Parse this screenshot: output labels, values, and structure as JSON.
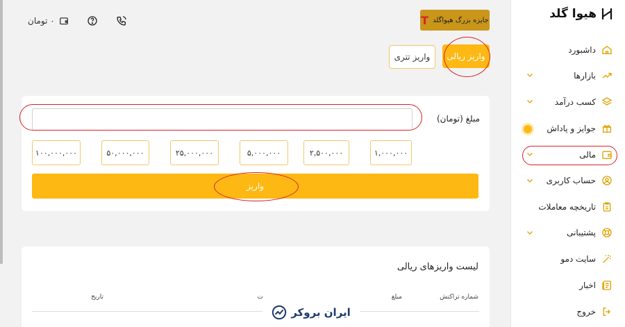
{
  "topbar": {
    "balance": "۰ تومان",
    "wallet_icon": "wallet-icon",
    "help_icon": "question-icon",
    "phone_icon": "phone-icon",
    "prize_label": "جایزه بزرگ هیواگلد",
    "prize_icon_letter": "T"
  },
  "tabs": [
    {
      "label": "واریز ریالی",
      "active": true
    },
    {
      "label": "واریز تتری",
      "active": false
    }
  ],
  "deposit": {
    "amount_label": "مبلغ (تومان)",
    "amount_value": "",
    "presets": [
      "۱,۰۰۰,۰۰۰",
      "۲,۵۰۰,۰۰۰",
      "۵,۰۰۰,۰۰۰",
      "۲۵,۰۰۰,۰۰۰",
      "۵۰,۰۰۰,۰۰۰",
      "۱۰۰,۰۰۰,۰۰۰"
    ],
    "submit_label": "واریز"
  },
  "list": {
    "title": "لیست واریزهای ریالی",
    "columns": [
      "شماره تراکنش",
      "مبلغ",
      "ت",
      "تاریخ"
    ]
  },
  "sidebar": {
    "logo_text": "هیوا گلد",
    "items": [
      {
        "label": "داشبورد",
        "icon": "home-icon",
        "has_chevron": false
      },
      {
        "label": "بازارها",
        "icon": "trending-up-icon",
        "has_chevron": true
      },
      {
        "label": "کسب درآمد",
        "icon": "layers-icon",
        "has_chevron": true
      },
      {
        "label": "جوایز و پاداش",
        "icon": "gift-icon",
        "has_chevron": false
      },
      {
        "label": "مالی",
        "icon": "wallet-icon",
        "has_chevron": true
      },
      {
        "label": "حساب کاربری",
        "icon": "user-icon",
        "has_chevron": true
      },
      {
        "label": "تاریخچه معاملات",
        "icon": "clipboard-icon",
        "has_chevron": false
      },
      {
        "label": "پشتیبانی",
        "icon": "lifebuoy-icon",
        "has_chevron": true
      },
      {
        "label": "سایت دمو",
        "icon": "magic-wand-icon",
        "has_chevron": false
      },
      {
        "label": "اخبار",
        "icon": "newspaper-icon",
        "has_chevron": false
      },
      {
        "label": "خروج",
        "icon": "logout-icon",
        "has_chevron": false
      }
    ]
  },
  "watermark": {
    "text": "ایران بروکر"
  },
  "colors": {
    "accent": "#fdb813",
    "annotation": "#d8232a",
    "dark_gold": "#c9961a"
  }
}
